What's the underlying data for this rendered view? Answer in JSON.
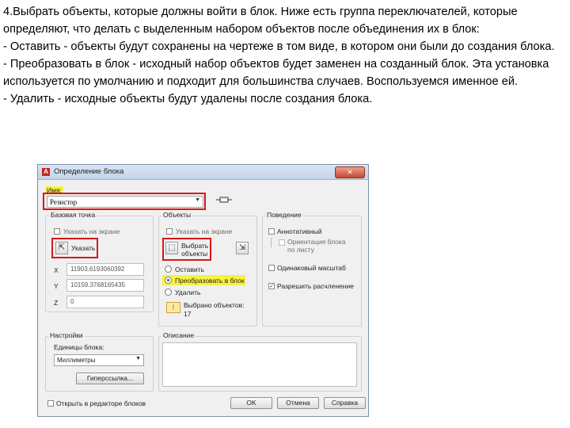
{
  "instructions": {
    "lines": [
      "4.Выбрать объекты, которые должны войти в блок. Ниже есть группа переключателей, которые определяют, что делать с выделенным набором объектов после объединения их в блок:",
      "- Оставить - объекты будут сохранены на чертеже в том виде, в котором они были до создания блока.",
      "- Преобразовать в блок - исходный набор объектов будет заменен на созданный блок. Эта установка используется по умолчанию и подходит для большинства случаев. Воспользуемся именное ей.",
      "- Удалить - исходные объекты будут удалены после создания блока."
    ]
  },
  "dialog": {
    "title": "Определение блока",
    "close_glyph": "✕",
    "name_label": "Имя:",
    "name_value": "Резистор",
    "base_point": {
      "title": "Базовая точка",
      "specify_on_screen": "Указать на экране",
      "pick_label": "Указать",
      "x_label": "X",
      "x_value": "11903.6193060392",
      "y_label": "Y",
      "y_value": "10159.3768165435",
      "z_label": "Z",
      "z_value": "0"
    },
    "objects": {
      "title": "Объекты",
      "specify_on_screen": "Указать на экране",
      "select_label": "Выбрать объекты",
      "retain": "Оставить",
      "convert": "Преобразовать в блок",
      "delete": "Удалить",
      "selected_label": "Выбрано объектов:",
      "selected_count": "17"
    },
    "behavior": {
      "title": "Поведение",
      "annotative": "Аннотативный",
      "match_orientation": "Ориентация блока по листу",
      "uniform_scale": "Одинаковый масштаб",
      "allow_explode": "Разрешить расчленение"
    },
    "settings": {
      "title": "Настройки",
      "units_label": "Единицы блока:",
      "units_value": "Миллиметры",
      "hyperlink": "Гиперссылка..."
    },
    "description": {
      "title": "Описание"
    },
    "open_in_editor": "Открыть в редакторе блоков",
    "ok": "OK",
    "cancel": "Отмена",
    "help": "Справка"
  }
}
